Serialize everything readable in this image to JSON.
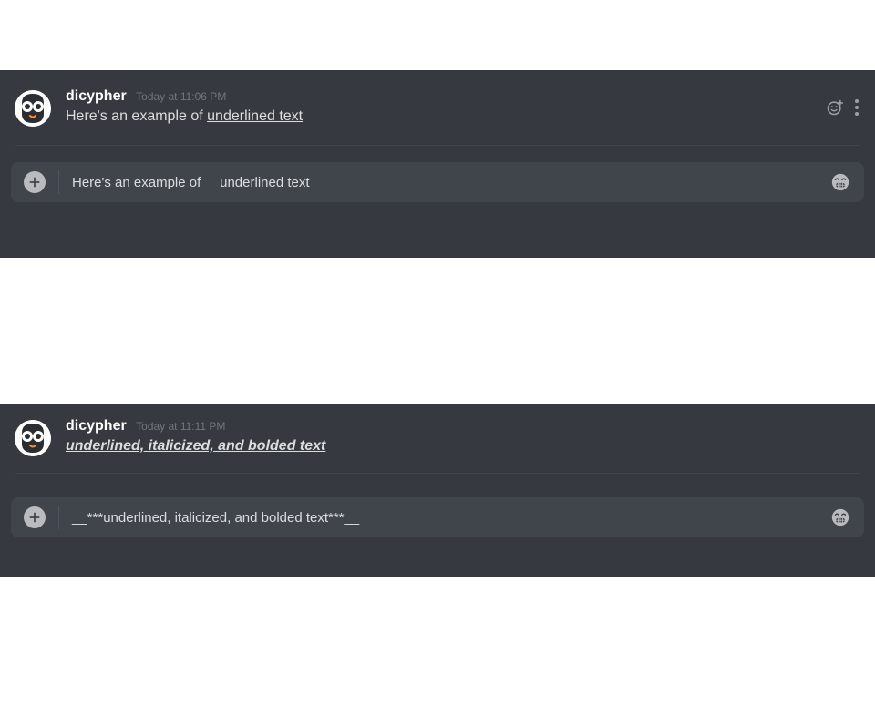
{
  "panels": [
    {
      "username": "dicypher",
      "timestamp": "Today at 11:06 PM",
      "message_prefix": "Here's an example of ",
      "message_underlined": "underlined text",
      "input_value": "Here's an example of __underlined text__"
    },
    {
      "username": "dicypher",
      "timestamp": "Today at 11:11 PM",
      "message_styled": "underlined, italicized, and bolded text",
      "input_value": "__***underlined, italicized, and bolded text***__"
    }
  ],
  "icons": {
    "plus": "plus-icon",
    "emoji": "grimace-icon",
    "react": "add-reaction-icon",
    "more": "more-icon"
  }
}
